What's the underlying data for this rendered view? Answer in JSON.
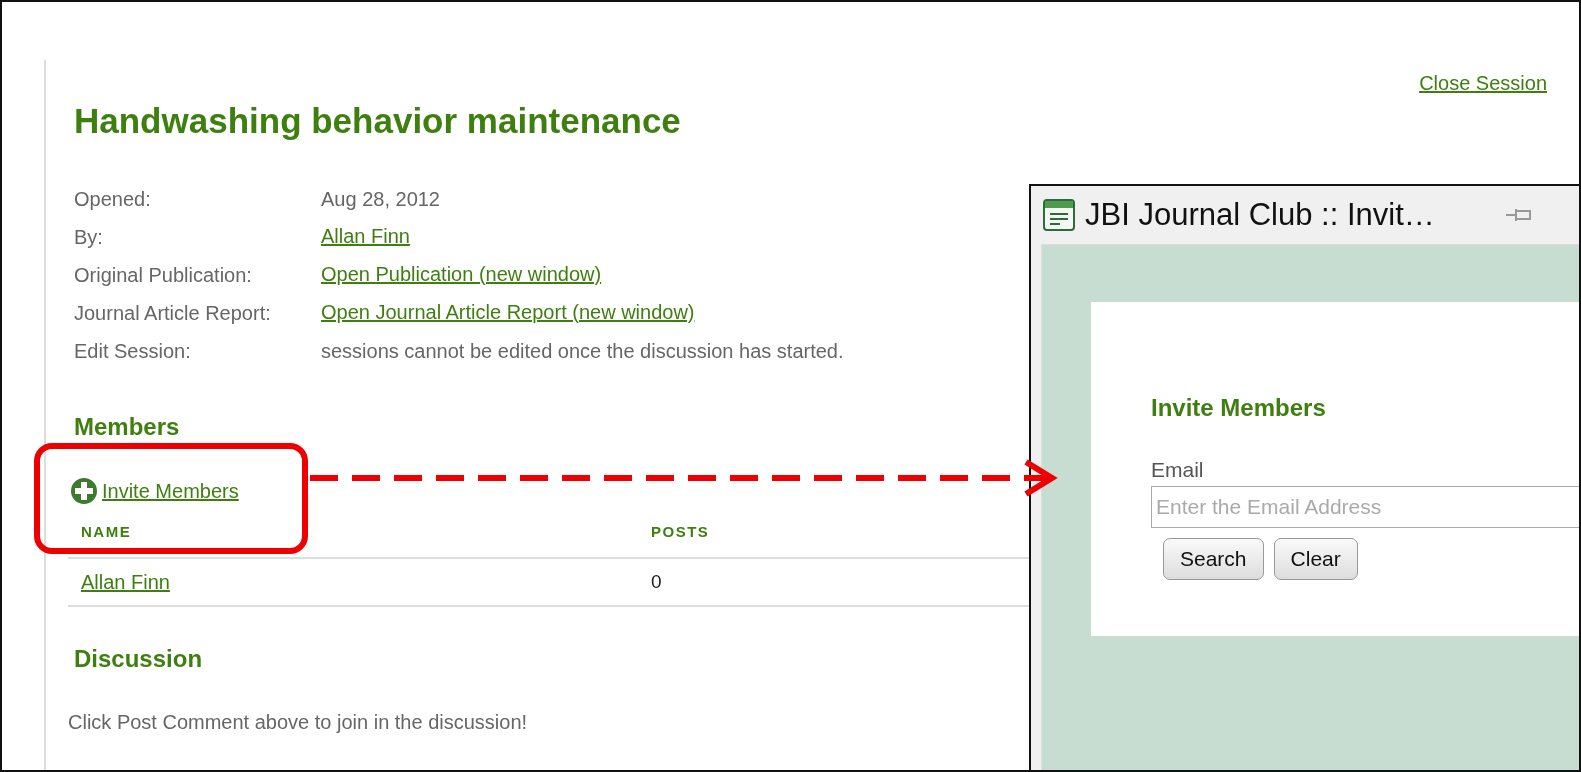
{
  "page": {
    "close_link": "Close Session",
    "title": "Handwashing behavior maintenance",
    "details": [
      {
        "label": "Opened:",
        "value": "Aug 28, 2012",
        "kind": "text"
      },
      {
        "label": "By:",
        "value": "Allan Finn",
        "kind": "link"
      },
      {
        "label": "Original Publication:",
        "value": "Open Publication (new window)",
        "kind": "link"
      },
      {
        "label": "Journal Article Report:",
        "value": "Open Journal Article Report (new window)",
        "kind": "link"
      },
      {
        "label": "Edit Session:",
        "value": "sessions cannot be edited once the discussion has started.",
        "kind": "text"
      }
    ],
    "members_heading": "Members",
    "invite_link": "Invite Members",
    "members_table": {
      "columns": [
        "NAME",
        "POSTS"
      ],
      "rows": [
        {
          "name": "Allan Finn",
          "posts": "0"
        }
      ]
    },
    "discussion_heading": "Discussion",
    "discussion_text": "Click Post Comment above to join in the discussion!"
  },
  "popup": {
    "title": "JBI Journal Club :: Invit…",
    "heading": "Invite Members",
    "email_label": "Email",
    "email_placeholder": "Enter the Email Address",
    "buttons": [
      "Search",
      "Clear"
    ]
  }
}
